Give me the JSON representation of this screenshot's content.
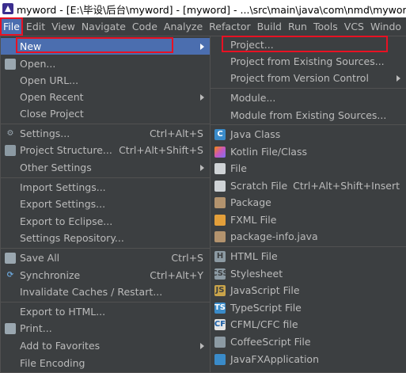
{
  "title": "myword - [E:\\毕设\\后台\\myword] - [myword] - ...\\src\\main\\java\\com\\nmd\\myword\\contr",
  "menubar": [
    "File",
    "Edit",
    "View",
    "Navigate",
    "Code",
    "Analyze",
    "Refactor",
    "Build",
    "Run",
    "Tools",
    "VCS",
    "Windo"
  ],
  "file_menu": [
    {
      "label": "New",
      "shortcut": "",
      "submenu": true,
      "icon": ""
    },
    {
      "label": "Open...",
      "shortcut": "",
      "submenu": false,
      "icon": "folder-icon"
    },
    {
      "label": "Open URL...",
      "shortcut": "",
      "submenu": false,
      "icon": ""
    },
    {
      "label": "Open Recent",
      "shortcut": "",
      "submenu": true,
      "icon": ""
    },
    {
      "label": "Close Project",
      "shortcut": "",
      "submenu": false,
      "icon": ""
    },
    {
      "label": "Settings...",
      "shortcut": "Ctrl+Alt+S",
      "submenu": false,
      "icon": "gear-icon"
    },
    {
      "label": "Project Structure...",
      "shortcut": "Ctrl+Alt+Shift+S",
      "submenu": false,
      "icon": "structure-icon"
    },
    {
      "label": "Other Settings",
      "shortcut": "",
      "submenu": true,
      "icon": ""
    },
    {
      "label": "Import Settings...",
      "shortcut": "",
      "submenu": false,
      "icon": ""
    },
    {
      "label": "Export Settings...",
      "shortcut": "",
      "submenu": false,
      "icon": ""
    },
    {
      "label": "Export to Eclipse...",
      "shortcut": "",
      "submenu": false,
      "icon": ""
    },
    {
      "label": "Settings Repository...",
      "shortcut": "",
      "submenu": false,
      "icon": ""
    },
    {
      "label": "Save All",
      "shortcut": "Ctrl+S",
      "submenu": false,
      "icon": "save-icon"
    },
    {
      "label": "Synchronize",
      "shortcut": "Ctrl+Alt+Y",
      "submenu": false,
      "icon": "sync-icon"
    },
    {
      "label": "Invalidate Caches / Restart...",
      "shortcut": "",
      "submenu": false,
      "icon": ""
    },
    {
      "label": "Export to HTML...",
      "shortcut": "",
      "submenu": false,
      "icon": ""
    },
    {
      "label": "Print...",
      "shortcut": "",
      "submenu": false,
      "icon": "print-icon"
    },
    {
      "label": "Add to Favorites",
      "shortcut": "",
      "submenu": true,
      "icon": ""
    },
    {
      "label": "File Encoding",
      "shortcut": "",
      "submenu": false,
      "icon": ""
    }
  ],
  "new_menu": [
    {
      "label": "Project...",
      "shortcut": "",
      "submenu": false,
      "icon": ""
    },
    {
      "label": "Project from Existing Sources...",
      "shortcut": "",
      "submenu": false,
      "icon": ""
    },
    {
      "label": "Project from Version Control",
      "shortcut": "",
      "submenu": true,
      "icon": ""
    },
    {
      "label": "Module...",
      "shortcut": "",
      "submenu": false,
      "icon": ""
    },
    {
      "label": "Module from Existing Sources...",
      "shortcut": "",
      "submenu": false,
      "icon": ""
    },
    {
      "label": "Java Class",
      "shortcut": "",
      "submenu": false,
      "icon": "java-class-icon"
    },
    {
      "label": "Kotlin File/Class",
      "shortcut": "",
      "submenu": false,
      "icon": "kotlin-icon"
    },
    {
      "label": "File",
      "shortcut": "",
      "submenu": false,
      "icon": "file-icon"
    },
    {
      "label": "Scratch File",
      "shortcut": "Ctrl+Alt+Shift+Insert",
      "submenu": false,
      "icon": "scratch-file-icon"
    },
    {
      "label": "Package",
      "shortcut": "",
      "submenu": false,
      "icon": "package-icon"
    },
    {
      "label": "FXML File",
      "shortcut": "",
      "submenu": false,
      "icon": "fxml-icon"
    },
    {
      "label": "package-info.java",
      "shortcut": "",
      "submenu": false,
      "icon": "package-info-icon"
    },
    {
      "label": "HTML File",
      "shortcut": "",
      "submenu": false,
      "icon": "html-icon"
    },
    {
      "label": "Stylesheet",
      "shortcut": "",
      "submenu": false,
      "icon": "css-icon"
    },
    {
      "label": "JavaScript File",
      "shortcut": "",
      "submenu": false,
      "icon": "javascript-icon"
    },
    {
      "label": "TypeScript File",
      "shortcut": "",
      "submenu": false,
      "icon": "typescript-icon"
    },
    {
      "label": "CFML/CFC file",
      "shortcut": "",
      "submenu": false,
      "icon": "cfml-icon"
    },
    {
      "label": "CoffeeScript File",
      "shortcut": "",
      "submenu": false,
      "icon": "coffeescript-icon"
    },
    {
      "label": "JavaFXApplication",
      "shortcut": "",
      "submenu": false,
      "icon": "javafx-icon"
    }
  ],
  "icon_glyphs": {
    "js": "JS",
    "ts": "TS",
    "cf": "CF",
    "css": "CSS",
    "html": "H",
    "kotlin": "K",
    "java": "C"
  },
  "colors": {
    "selection": "#4b6eaf",
    "highlight_box": "#e81123",
    "menu_bg": "#3c3f41"
  }
}
